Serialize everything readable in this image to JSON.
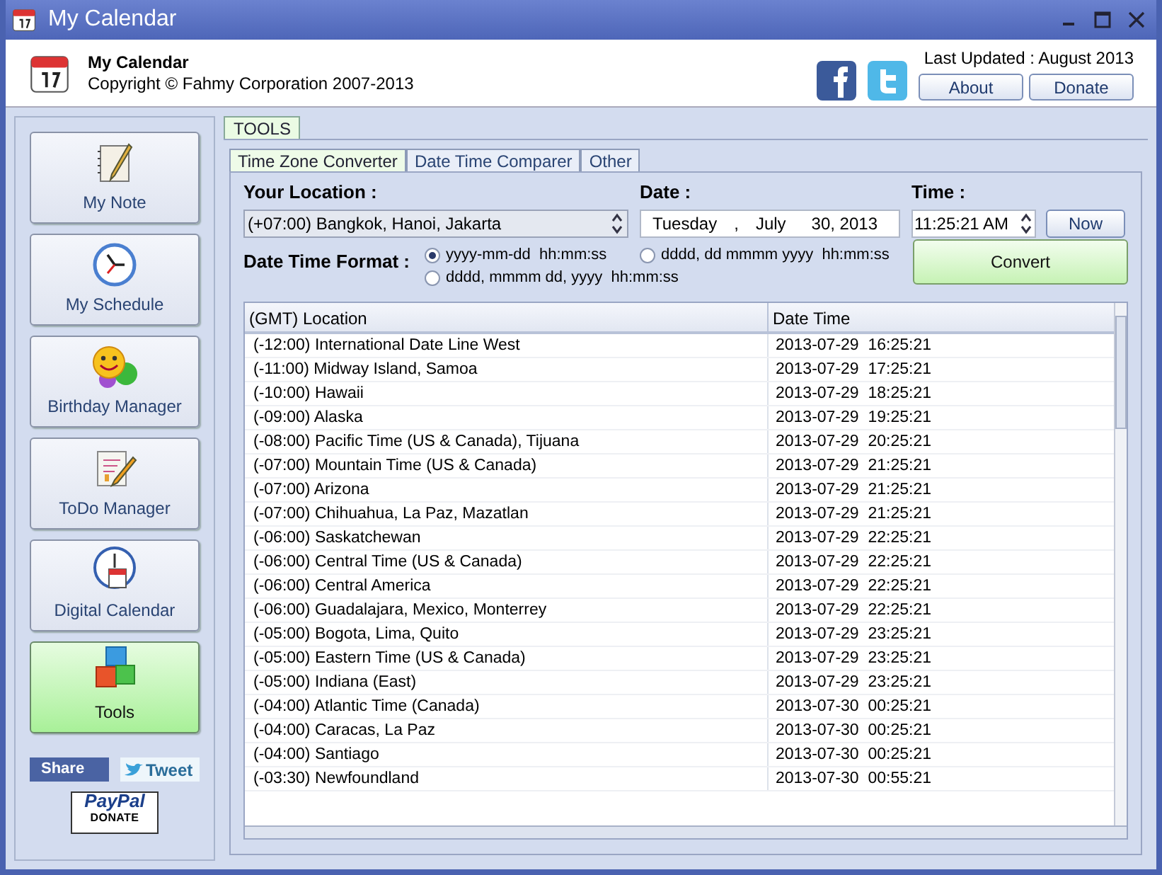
{
  "window": {
    "title": "My Calendar"
  },
  "header": {
    "app_name": "My Calendar",
    "copyright": "Copyright © Fahmy Corporation 2007-2013",
    "last_updated": "Last Updated : August 2013",
    "buttons": [
      "About",
      "Donate"
    ]
  },
  "sidebar": {
    "items": [
      {
        "label": "My Note",
        "kind": "note",
        "selected": false
      },
      {
        "label": "My Schedule",
        "kind": "clock",
        "selected": false
      },
      {
        "label": "Birthday Manager",
        "kind": "smiley",
        "selected": false
      },
      {
        "label": "ToDo Manager",
        "kind": "todo",
        "selected": false
      },
      {
        "label": "Digital Calendar",
        "kind": "calendar",
        "selected": false
      },
      {
        "label": "Tools",
        "kind": "cubes",
        "selected": true
      }
    ],
    "share": "Share",
    "tweet": "Tweet",
    "paypal": {
      "brand": "PayPal",
      "action": "DONATE"
    }
  },
  "outer_tab": {
    "label": "TOOLS"
  },
  "tabs": [
    {
      "label": "Time Zone Converter",
      "selected": true
    },
    {
      "label": "Date Time Comparer",
      "selected": false
    },
    {
      "label": "Other",
      "selected": false
    }
  ],
  "form": {
    "location_label": "Your Location :",
    "location_value": "(+07:00) Bangkok, Hanoi, Jakarta",
    "date_label": "Date :",
    "date": {
      "weekday": "Tuesday",
      "separator": ",",
      "month": "July",
      "day_year": "30, 2013"
    },
    "time_label": "Time :",
    "time_value": "11:25:21 AM",
    "now_button": "Now",
    "format_label": "Date Time Format :",
    "formats": [
      {
        "label": "yyyy-mm-dd  hh:mm:ss",
        "selected": true
      },
      {
        "label": "dddd, dd mmmm yyyy  hh:mm:ss",
        "selected": false
      },
      {
        "label": "dddd, mmmm dd, yyyy  hh:mm:ss",
        "selected": false
      }
    ],
    "convert_button": "Convert"
  },
  "table": {
    "columns": [
      "(GMT) Location",
      "Date Time"
    ],
    "rows": [
      [
        "(-12:00) International Date Line West",
        "2013-07-29  16:25:21"
      ],
      [
        "(-11:00) Midway Island, Samoa",
        "2013-07-29  17:25:21"
      ],
      [
        "(-10:00) Hawaii",
        "2013-07-29  18:25:21"
      ],
      [
        "(-09:00) Alaska",
        "2013-07-29  19:25:21"
      ],
      [
        "(-08:00) Pacific Time (US & Canada), Tijuana",
        "2013-07-29  20:25:21"
      ],
      [
        "(-07:00) Mountain Time (US & Canada)",
        "2013-07-29  21:25:21"
      ],
      [
        "(-07:00) Arizona",
        "2013-07-29  21:25:21"
      ],
      [
        "(-07:00) Chihuahua, La Paz, Mazatlan",
        "2013-07-29  21:25:21"
      ],
      [
        "(-06:00) Saskatchewan",
        "2013-07-29  22:25:21"
      ],
      [
        "(-06:00) Central Time (US & Canada)",
        "2013-07-29  22:25:21"
      ],
      [
        "(-06:00) Central America",
        "2013-07-29  22:25:21"
      ],
      [
        "(-06:00) Guadalajara, Mexico, Monterrey",
        "2013-07-29  22:25:21"
      ],
      [
        "(-05:00) Bogota, Lima, Quito",
        "2013-07-29  23:25:21"
      ],
      [
        "(-05:00) Eastern Time (US & Canada)",
        "2013-07-29  23:25:21"
      ],
      [
        "(-05:00) Indiana (East)",
        "2013-07-29  23:25:21"
      ],
      [
        "(-04:00) Atlantic Time (Canada)",
        "2013-07-30  00:25:21"
      ],
      [
        "(-04:00) Caracas, La Paz",
        "2013-07-30  00:25:21"
      ],
      [
        "(-04:00) Santiago",
        "2013-07-30  00:25:21"
      ],
      [
        "(-03:30) Newfoundland",
        "2013-07-30  00:55:21"
      ]
    ]
  }
}
